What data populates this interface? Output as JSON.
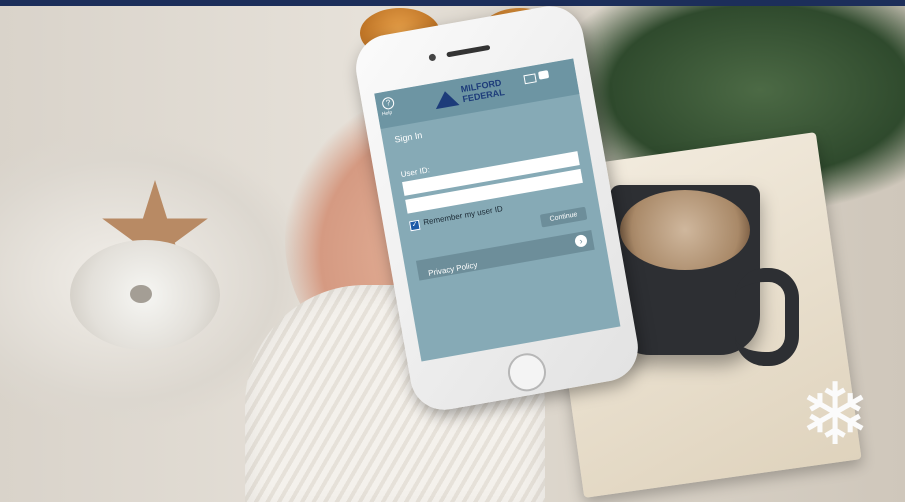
{
  "app": {
    "help_label": "Help",
    "logo_line1": "MILFORD",
    "logo_line2": "FEDERAL",
    "title": "Sign In",
    "user_id_label": "User ID:",
    "remember_label": "Remember my user ID",
    "continue_label": "Continue",
    "privacy_label": "Privacy Policy",
    "icons": [
      "help-icon",
      "mail-icon",
      "message-icon",
      "chevron-right-icon"
    ]
  },
  "colors": {
    "screen": "#86aab6",
    "appbar": "#6d95a3",
    "brand": "#1d3c7a",
    "top_bar": "#1c2e5a"
  }
}
